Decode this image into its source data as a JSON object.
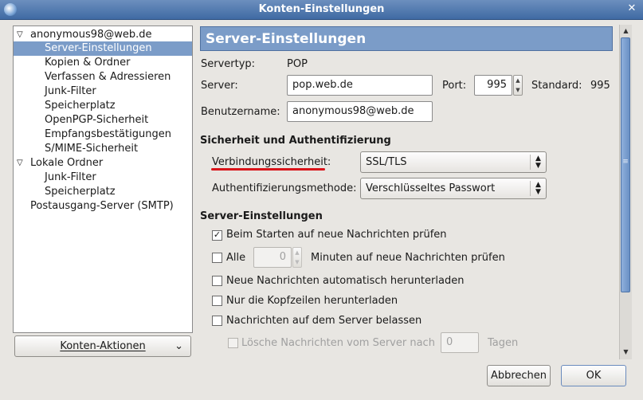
{
  "window": {
    "title": "Konten-Einstellungen",
    "close_glyph": "✕"
  },
  "sidebar": {
    "items": [
      {
        "label": "anonymous98@web.de",
        "expander": "▽"
      },
      {
        "label": "Server-Einstellungen"
      },
      {
        "label": "Kopien & Ordner"
      },
      {
        "label": "Verfassen & Adressieren"
      },
      {
        "label": "Junk-Filter"
      },
      {
        "label": "Speicherplatz"
      },
      {
        "label": "OpenPGP-Sicherheit"
      },
      {
        "label": "Empfangsbestätigungen"
      },
      {
        "label": "S/MIME-Sicherheit"
      },
      {
        "label": "Lokale Ordner",
        "expander": "▽"
      },
      {
        "label": "Junk-Filter"
      },
      {
        "label": "Speicherplatz"
      },
      {
        "label": "Postausgang-Server (SMTP)"
      }
    ],
    "selected_index": 1,
    "actions_label": "Konten-Aktionen",
    "actions_icon": "chevron-down-icon"
  },
  "main": {
    "header": "Server-Einstellungen",
    "server_type_label": "Servertyp:",
    "server_type_value": "POP",
    "server_label": "Server:",
    "server_value": "pop.web.de",
    "port_label": "Port:",
    "port_value": "995",
    "standard_label": "Standard:",
    "standard_value": "995",
    "username_label": "Benutzername:",
    "username_value": "anonymous98@web.de",
    "security_section": "Sicherheit und Authentifizierung",
    "connection_security_label": "Verbindungssicherheit:",
    "connection_security_value": "SSL/TLS",
    "auth_method_label": "Authentifizierungsmethode:",
    "auth_method_value": "Verschlüsseltes Passwort",
    "server_settings_section": "Server-Einstellungen",
    "check_on_start_label": "Beim Starten auf neue Nachrichten prüfen",
    "check_on_start_checked": true,
    "check_every_label": "Alle",
    "check_every_value": "0",
    "check_every_suffix": "Minuten auf neue Nachrichten prüfen",
    "check_every_checked": false,
    "auto_download_label": "Neue Nachrichten automatisch herunterladen",
    "auto_download_checked": false,
    "headers_only_label": "Nur die Kopfzeilen herunterladen",
    "headers_only_checked": false,
    "leave_on_server_label": "Nachrichten auf dem Server belassen",
    "leave_on_server_checked": false,
    "delete_after_label": "Lösche Nachrichten vom Server nach",
    "delete_after_value": "0",
    "delete_after_suffix": "Tagen",
    "delete_after_checked": false
  },
  "buttons": {
    "cancel": "Abbrechen",
    "ok": "OK"
  },
  "colors": {
    "selection": "#7b9cc8",
    "titlebar": "#3f6aa3",
    "annotation_underline": "#d9141a"
  }
}
